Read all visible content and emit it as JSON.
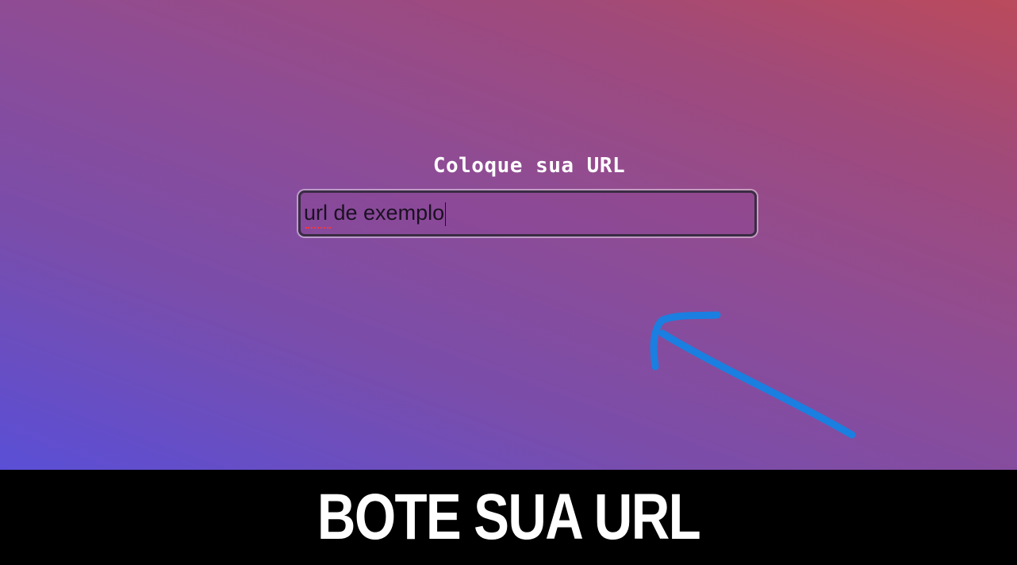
{
  "form": {
    "label": "Coloque sua URL",
    "url_input": {
      "value": "url de exemplo",
      "placeholder": ""
    }
  },
  "annotation": {
    "arrow_color": "#1a7fe0",
    "arrow_icon": "hand-drawn-arrow-icon"
  },
  "caption": {
    "text": "BOTE SUA URL"
  },
  "colors": {
    "background_gradient": [
      "#5a4fd6",
      "#8e4c95",
      "#bb4a5c"
    ],
    "caption_bar": "#000000",
    "label_text": "#ffffff"
  }
}
